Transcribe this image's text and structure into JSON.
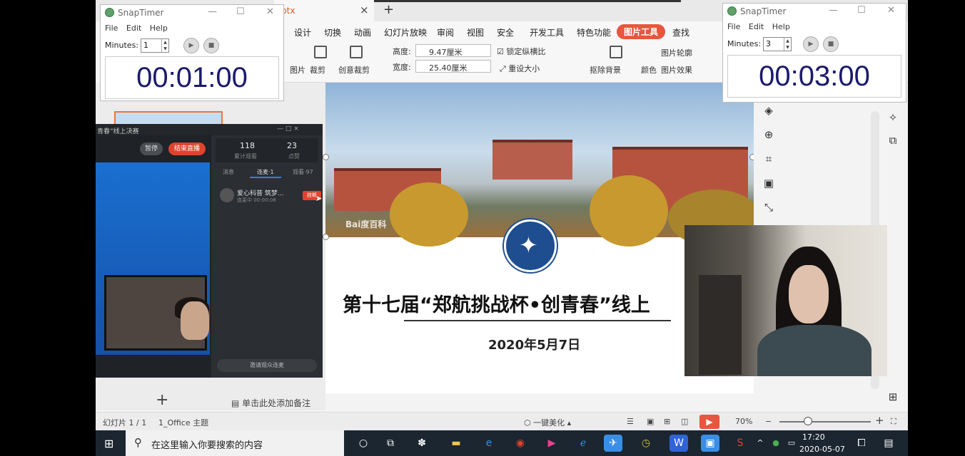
{
  "wps": {
    "doc_tab": "ptx",
    "doc_tab_close": "×",
    "new_tab": "+",
    "menu": [
      "设计",
      "切换",
      "动画",
      "幻灯片放映",
      "审阅",
      "视图",
      "安全",
      "开发工具",
      "特色功能",
      "图片工具",
      "查找"
    ],
    "tools": {
      "pic": "图片",
      "crop": "裁剪",
      "creative_crop": "创意裁剪",
      "height_label": "高度:",
      "height_value": "9.47厘米",
      "width_label": "宽度:",
      "width_value": "25.40厘米",
      "lock_ratio": "锁定纵横比",
      "reset_size": "重设大小",
      "remove_bg": "抠除背景",
      "color": "颜色",
      "pic_outline": "图片轮廓",
      "pic_effect": "图片效果"
    },
    "notes_placeholder": "单击此处添加备注",
    "status": {
      "slide_info": "幻灯片 1 / 1",
      "theme": "1_Office 主题",
      "beautify": "一键美化",
      "zoom": "70%",
      "minus": "−",
      "plus": "+"
    },
    "add_slide": "+"
  },
  "slide": {
    "watermark": "Bai度百科",
    "title": "第十七届“郑航挑战杯•创青春”线上",
    "date": "2020年5月7日"
  },
  "live": {
    "window_title": "青春”线上决赛",
    "window_controls": "—  □  ×",
    "pause": "暂停",
    "end_live": "结束直播",
    "stats": [
      {
        "value": "118",
        "label": "累计观看"
      },
      {
        "value": "23",
        "label": "点赞"
      }
    ],
    "tabs": [
      "消息",
      "连麦·1",
      "观看·97"
    ],
    "caller_name": "爱心科普 筑梦...",
    "caller_status": "连麦中 00:00:08",
    "hangup": "挂断",
    "invite": "邀请观众连麦"
  },
  "timers": [
    {
      "title": "SnapTimer",
      "menu": [
        "File",
        "Edit",
        "Help"
      ],
      "minutes_label": "Minutes:",
      "minutes": "1",
      "display": "00:01:00"
    },
    {
      "title": "SnapTimer",
      "menu": [
        "File",
        "Edit",
        "Help"
      ],
      "minutes_label": "Minutes:",
      "minutes": "3",
      "display": "00:03:00"
    }
  ],
  "taskbar": {
    "start_icon": "windows-logo",
    "search_placeholder": "在这里输入你要搜索的内容",
    "time": "17:20",
    "date": "2020-05-07"
  },
  "colors": {
    "accent": "#e8563e",
    "taskbar": "#1b2630",
    "timer_digits": "#1a1a6e"
  }
}
